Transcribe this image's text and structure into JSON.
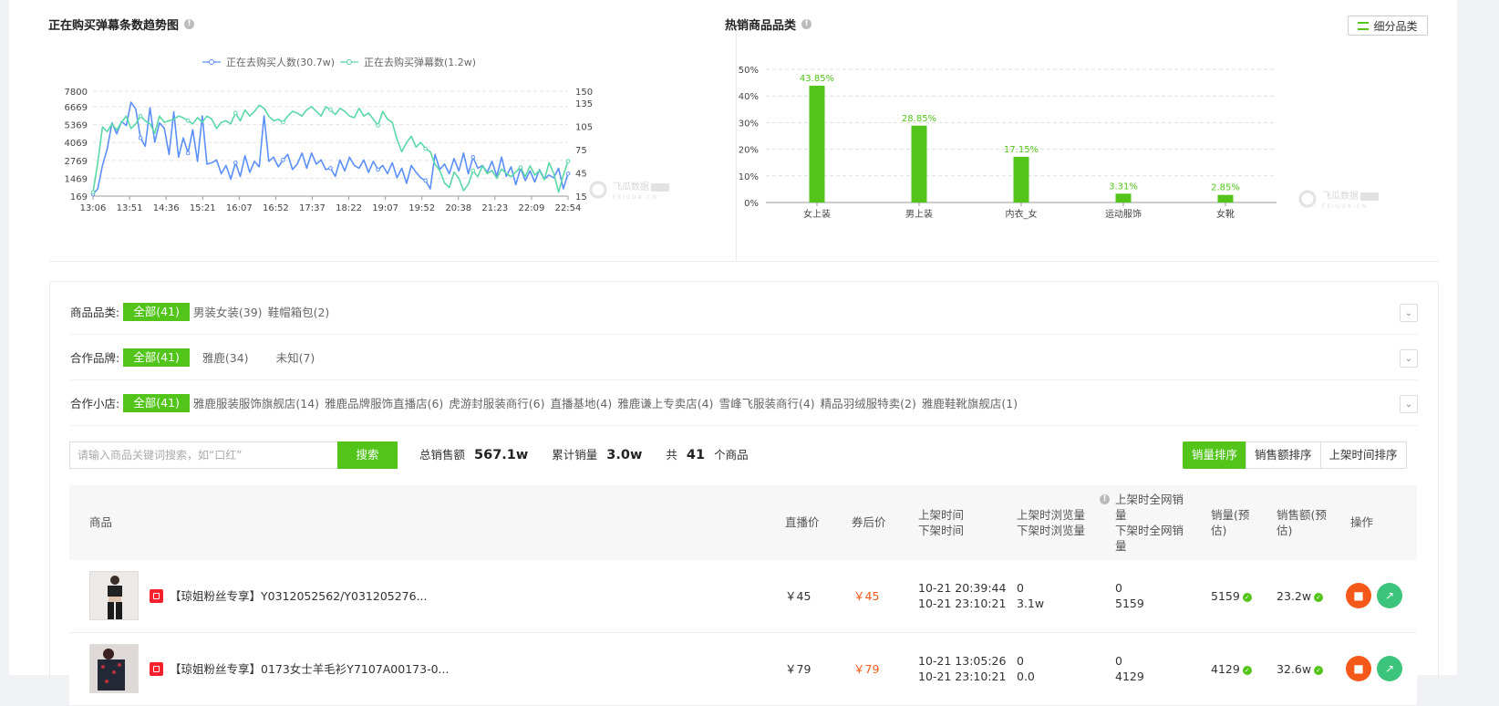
{
  "left_panel": {
    "title": "正在购买弹幕条数趋势图",
    "legend": [
      "正在去购买人数(30.7w)",
      "正在去购买弹幕数(1.2w)"
    ],
    "watermark": "飞瓜数据"
  },
  "right_panel": {
    "title": "热销商品品类",
    "subcategory_button": "细分品类",
    "watermark": "飞瓜数据"
  },
  "chart_data": [
    {
      "type": "line",
      "title": "正在购买弹幕条数趋势图",
      "x_ticks": [
        "13:06",
        "13:51",
        "14:36",
        "15:21",
        "16:07",
        "16:52",
        "17:37",
        "18:22",
        "19:07",
        "19:52",
        "20:38",
        "21:23",
        "22:09",
        "22:54"
      ],
      "y_left_ticks": [
        169,
        1469,
        2769,
        4069,
        5369,
        6669,
        7800
      ],
      "y_right_ticks": [
        15,
        45,
        75,
        105,
        135,
        150
      ],
      "ylim_left": [
        169,
        7800
      ],
      "ylim_right": [
        15,
        150
      ],
      "series": [
        {
          "name": "正在去购买人数(30.7w)",
          "axis": "left",
          "color": "#5b8ff9",
          "values": [
            300,
            700,
            2400,
            3600,
            5500,
            4700,
            5600,
            5300,
            7000,
            6500,
            4400,
            3800,
            6600,
            4100,
            5500,
            5100,
            3200,
            6300,
            3000,
            4400,
            3300,
            5000,
            2700,
            6000,
            2500,
            2600,
            2800,
            1800,
            2400,
            1400,
            2600,
            1600,
            3100,
            1900,
            2700,
            2300,
            6000,
            2700,
            3000,
            2300,
            2800,
            3200,
            2100,
            2500,
            3300,
            2200,
            3300,
            2500,
            2800,
            2100,
            2200,
            1600,
            2800,
            2000,
            3000,
            2400,
            2200,
            2800,
            1900,
            2700,
            2100,
            2400,
            1800,
            2600,
            1500,
            2200,
            1100,
            2400,
            1900,
            1500,
            1300,
            700,
            3200,
            2100,
            2500,
            1800,
            2900,
            2000,
            3300,
            1800,
            3000,
            2200,
            2400,
            1900,
            2700,
            1600,
            3000,
            1600,
            2300,
            1000,
            2200,
            1300,
            2000,
            1200,
            2100,
            1400,
            1700,
            1500,
            2200,
            700,
            1800
          ]
        },
        {
          "name": "正在去购买弹幕数(1.2w)",
          "axis": "right",
          "color": "#5ad8a6",
          "values": [
            20,
            58,
            104,
            98,
            108,
            100,
            110,
            118,
            102,
            108,
            118,
            112,
            108,
            96,
            118,
            110,
            112,
            114,
            118,
            116,
            112,
            108,
            116,
            110,
            118,
            114,
            102,
            110,
            112,
            108,
            122,
            112,
            126,
            118,
            124,
            132,
            128,
            118,
            112,
            114,
            110,
            118,
            124,
            122,
            118,
            126,
            130,
            124,
            118,
            130,
            126,
            120,
            128,
            124,
            118,
            116,
            128,
            118,
            122,
            114,
            106,
            124,
            114,
            110,
            88,
            72,
            84,
            92,
            78,
            84,
            76,
            72,
            56,
            48,
            32,
            26,
            46,
            38,
            22,
            30,
            48,
            40,
            54,
            44,
            48,
            38,
            50,
            44,
            40,
            46,
            52,
            40,
            54,
            42,
            48,
            36,
            58,
            44,
            20,
            42,
            60
          ]
        }
      ]
    },
    {
      "type": "bar",
      "title": "热销商品品类",
      "categories": [
        "女上装",
        "男上装",
        "内衣_女",
        "运动服饰",
        "女靴"
      ],
      "values": [
        43.85,
        28.85,
        17.15,
        3.31,
        2.85
      ],
      "data_labels": [
        "43.85%",
        "28.85%",
        "17.15%",
        "3.31%",
        "2.85%"
      ],
      "y_ticks": [
        "0%",
        "10%",
        "20%",
        "30%",
        "40%",
        "50%"
      ],
      "ylim": [
        0,
        50
      ],
      "color": "#52c41a"
    }
  ],
  "filters": [
    {
      "label": "商品品类:",
      "active": "全部(41)",
      "options": [
        "男装女装(39)",
        "鞋帽箱包(2)"
      ]
    },
    {
      "label": "合作品牌:",
      "active": "全部(41)",
      "options": [
        "雅鹿(34)",
        "未知(7)"
      ]
    },
    {
      "label": "合作小店:",
      "active": "全部(41)",
      "options": [
        "雅鹿服装服饰旗舰店(14)",
        "雅鹿品牌服饰直播店(6)",
        "虎游封服装商行(6)",
        "直播基地(4)",
        "雅鹿谦上专卖店(4)",
        "雪峰飞服装商行(4)",
        "精品羽绒服特卖(2)",
        "雅鹿鞋靴旗舰店(1)"
      ]
    }
  ],
  "search": {
    "placeholder": "请输入商品关键词搜索，如“口红”",
    "button": "搜索"
  },
  "stats": {
    "sales_amount_label": "总销售额",
    "sales_amount": "567.1w",
    "sales_volume_label": "累计销量",
    "sales_volume": "3.0w",
    "total_prefix": "共",
    "total_count": "41",
    "total_suffix": "个商品"
  },
  "sort_buttons": [
    "销量排序",
    "销售额排序",
    "上架时间排序"
  ],
  "table": {
    "headers": {
      "product": "商品",
      "live_price": "直播价",
      "coupon_price": "券后价",
      "time_1": "上架时间",
      "time_2": "下架时间",
      "views_1": "上架时浏览量",
      "views_2": "下架时浏览量",
      "net_sales_1": "上架时全网销量",
      "net_sales_2": "下架时全网销量",
      "sales": "销量(预估)",
      "revenue": "销售额(预估)",
      "ops": "操作"
    },
    "rows": [
      {
        "title": "【琼姐粉丝专享】Y0312052562/Y031205276...",
        "live_price": "￥45",
        "coupon_price": "￥45",
        "on_time": "10-21 20:39:44",
        "off_time": "10-21 23:10:21",
        "views_on": "0",
        "views_off": "3.1w",
        "net_on": "0",
        "net_off": "5159",
        "sales": "5159",
        "revenue": "23.2w"
      },
      {
        "title": "【琼姐粉丝专享】0173女士羊毛衫Y7107A00173-0...",
        "live_price": "￥79",
        "coupon_price": "￥79",
        "on_time": "10-21 13:05:26",
        "off_time": "10-21 23:10:21",
        "views_on": "0",
        "views_off": "0.0",
        "net_on": "0",
        "net_off": "4129",
        "sales": "4129",
        "revenue": "32.6w"
      }
    ]
  }
}
